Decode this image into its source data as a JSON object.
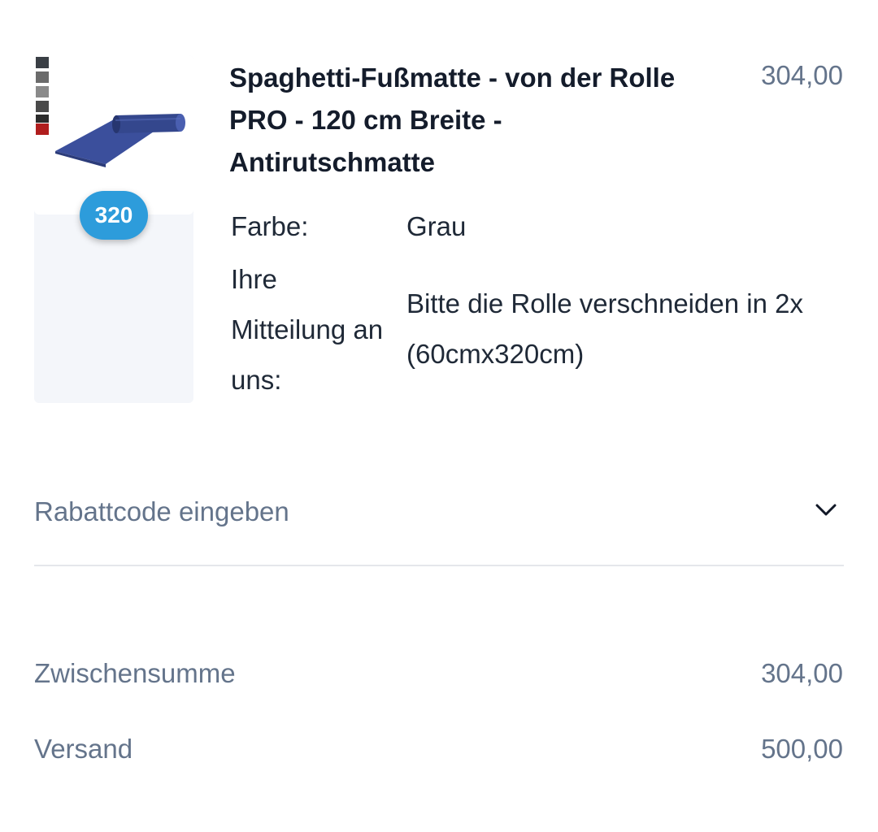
{
  "cart_item": {
    "image_icon": "rolled-mat-product-image",
    "swatch_colors": [
      "#3a3f45",
      "#6b6b6b",
      "#8a8a8a",
      "#4a4a4a",
      "#2b2b2b",
      "#b01d1d"
    ],
    "quantity": "320",
    "title": "Spaghetti-Fußmatte - von der Rolle PRO - 120 cm Breite - Antirutschmatte",
    "price": "304,00",
    "options": [
      {
        "label": "Farbe:",
        "value": "Grau"
      },
      {
        "label": "Ihre Mitteilung an uns:",
        "value": "Bitte die Rolle verschneiden in 2x (60cmx320cm)"
      }
    ]
  },
  "discount": {
    "label": "Rabattcode eingeben",
    "icon": "chevron-down-icon"
  },
  "summary": {
    "subtotal_label": "Zwischensumme",
    "subtotal_value": "304,00",
    "shipping_label": "Versand",
    "shipping_value": "500,00"
  },
  "colors": {
    "badge": "#2d9cdb",
    "title": "#141c2b",
    "muted": "#64748b",
    "mat": "#3b4f9c"
  }
}
